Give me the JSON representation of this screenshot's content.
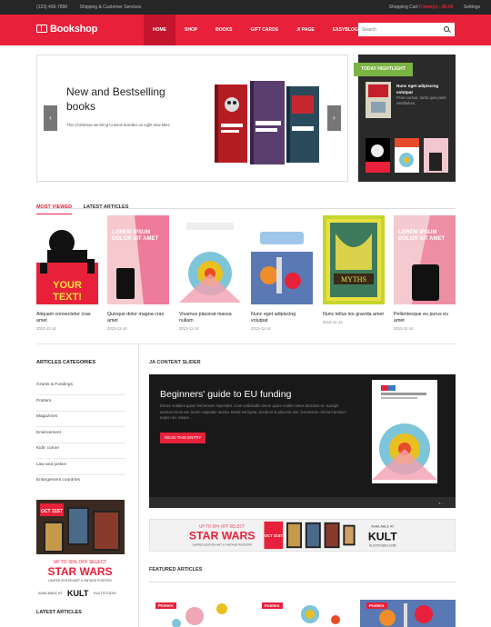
{
  "topbar": {
    "phone": "(123) 456-7890",
    "shipping": "Shipping & Customer Services",
    "cart_label": "Shopping Cart",
    "cart_items": "0 item(s)",
    "cart_total": "$0.00",
    "settings": "Settings"
  },
  "header": {
    "logo": "Bookshop",
    "nav": [
      "HOME",
      "SHOP",
      "BOOKS",
      "GIFT CARDS",
      "J! PAGE",
      "EASYBLOG"
    ],
    "search_placeholder": "Search"
  },
  "slider": {
    "title": "New and Bestselling books",
    "subtitle": "This Christmas we bring to Book bundles on eight new titles"
  },
  "today": {
    "heading": "TODAY HIGHTLIGHT",
    "title": "Nunc eget adipiscing volutpat",
    "text": "Proin cursus, tortor quis pede vestibulum,"
  },
  "tabs": {
    "most_viewed": "MOST VIEWED",
    "latest": "LATEST ARTICLES"
  },
  "books": [
    {
      "title": "Aliquam consectetur cras amet",
      "date": "2013-11-14"
    },
    {
      "title": "Quisque dolor magna cras amet",
      "date": "2013-11-14"
    },
    {
      "title": "Vivamus placerat massa nullam",
      "date": "2013-11-14"
    },
    {
      "title": "Nunc eget adipiscing volutpat",
      "date": "2013-11-14"
    },
    {
      "title": "Nunc tellus leo gravida amet",
      "date": "2013-11-14"
    },
    {
      "title": "Pellentesque eu purus eu amet",
      "date": "2013-11-14"
    }
  ],
  "sidebar": {
    "categories_heading": "ARTICLES CATEGORIES",
    "categories": [
      "Grants & Fundings",
      "Posters",
      "Magazines",
      "Environment",
      "Kids' corner",
      "Law and justice",
      "Enlargement countries"
    ],
    "latest_heading": "LATEST ARTICLES"
  },
  "content_slider": {
    "heading": "JA CONTENT SLIDER",
    "title": "Beginners' guide to EU funding",
    "text": "Donec sodales quam fermentum imperdiet. Cras sollicitudin lorem quam mattis metus tincidunt et, suscipit aenean lacus est, lorem vulputate lacinia. Morbi est ligula, tincidunt id placerat nisi, fermentum nisl sed pretium turpis nisi. Suspe...",
    "button": "READ THIS ENTRY"
  },
  "banner": {
    "promo": "UP TO 30% OFF SELECT",
    "brand": "STAR WARS",
    "sub": "LIMITED EDITION ART & VINTAGE POSTERS",
    "date": "OCT 31ST",
    "avail": "AVAILABLE AT",
    "kult": "KULT",
    "site": "KULTSTUDIO.COM"
  },
  "side_ad": {
    "date": "OCT 31ST",
    "promo": "UP TO 30% OFF SELECT",
    "brand": "STAR WARS",
    "sub": "LIMITED EDITION ART & VINTAGE POSTERS",
    "avail": "AVAILABLE AT",
    "kult": "KULT",
    "site": "KULTSTUDIO"
  },
  "featured": {
    "heading": "FEATURED ARTICLES",
    "labels": [
      "Posters",
      "Posters",
      "Posters"
    ]
  },
  "colors": {
    "accent": "#e8203a",
    "dark": "#262626",
    "green": "#7bb342"
  }
}
